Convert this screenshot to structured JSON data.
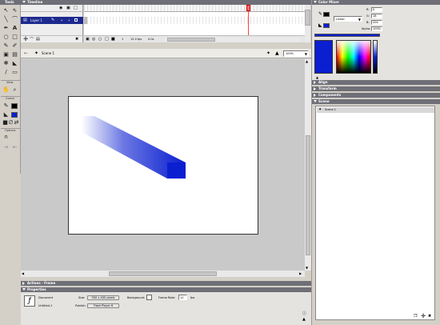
{
  "tools": {
    "title": "Tools",
    "group_tools": [
      "arrow",
      "subselect",
      "line",
      "lasso",
      "pen",
      "text",
      "oval",
      "rect",
      "pencil",
      "brush",
      "free-transform",
      "fill-transform",
      "ink-bottle",
      "paint-bucket",
      "eyedropper",
      "eraser"
    ],
    "view_label": "View",
    "colors_label": "Colors",
    "options_label": "Options"
  },
  "timeline": {
    "title": "Timeline",
    "layer_name": "Layer 1",
    "status": [
      "1",
      "12.0 fps",
      "0.0s"
    ]
  },
  "scene_bar": {
    "scene_name": "Scene 1",
    "zoom": "100%"
  },
  "actions_panel": {
    "title": "Actions - Frame"
  },
  "properties": {
    "title": "Properties",
    "doc_type": "Document",
    "doc_name": "Untitled-1",
    "size_label": "Size:",
    "size_value": "550 x 400 pixels",
    "background_label": "Background:",
    "frame_rate_label": "Frame Rate:",
    "frame_rate_value": "12",
    "fps_unit": "fps",
    "publish_label": "Publish:",
    "publish_value": "Flash Player 6"
  },
  "color_mixer": {
    "title": "Color Mixer",
    "fill_style": "Linear",
    "r_label": "R:",
    "r_value": "0",
    "g_label": "G:",
    "g_value": "18",
    "b_label": "B:",
    "b_value": "204",
    "alpha_label": "Alpha:",
    "alpha_value": "100%"
  },
  "panels": {
    "align": "Align",
    "transform": "Transform",
    "components": "Components",
    "scene": "Scene",
    "scene_item": "Scene 1"
  },
  "colors": {
    "chrome": "#d4d0c8",
    "stage_bg": "#c9c9c9",
    "panel_header": "#6f6f78",
    "shape_fill": "#0a1fd0",
    "playhead": "#ff4040"
  }
}
